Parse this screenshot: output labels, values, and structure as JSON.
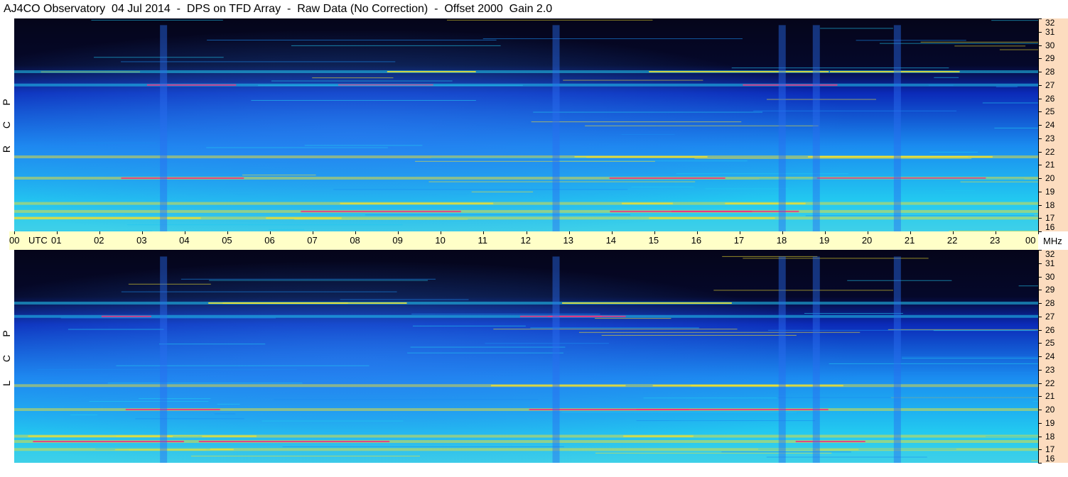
{
  "title": "AJ4CO Observatory  04 Jul 2014  -  DPS on TFD Array  -  Raw Data (No Correction)  -  Offset 2000  Gain 2.0",
  "colors": {
    "background_dark": "#05051a",
    "low": "#0a30c8",
    "mid": "#1a8cf0",
    "high": "#22c8f0",
    "hot": "#f0e030",
    "peak": "#f03080",
    "freq_axis_bg": "#fcdcbf",
    "time_axis_bg": "#ffffc8"
  },
  "chart_data": [
    {
      "type": "heatmap",
      "name": "R C P",
      "panel_label": [
        "R",
        "C",
        "P"
      ],
      "xlabel": "UTC",
      "ylabel": "MHz",
      "xlim": [
        0,
        24
      ],
      "ylim": [
        16,
        32
      ],
      "y_ticks": [
        "16",
        "17",
        "18",
        "19",
        "20",
        "21",
        "22",
        "23",
        "24",
        "25",
        "26",
        "27",
        "28",
        "29",
        "30",
        "31",
        "32"
      ],
      "bright_bands_mhz": [
        17.0,
        17.5,
        18.1,
        20.0,
        21.6,
        27.0,
        28.0
      ],
      "vertical_bursts_utc": [
        3.5,
        12.7,
        18.0,
        18.8,
        20.7
      ]
    },
    {
      "type": "heatmap",
      "name": "L C P",
      "panel_label": [
        "L",
        "C",
        "P"
      ],
      "xlabel": "UTC",
      "ylabel": "MHz",
      "xlim": [
        0,
        24
      ],
      "ylim": [
        16,
        32
      ],
      "y_ticks": [
        "16",
        "17",
        "18",
        "19",
        "20",
        "21",
        "22",
        "23",
        "24",
        "25",
        "26",
        "27",
        "28",
        "29",
        "30",
        "31",
        "32"
      ],
      "bright_bands_mhz": [
        17.0,
        17.6,
        18.0,
        20.0,
        21.8,
        27.0,
        28.0
      ],
      "vertical_bursts_utc": [
        3.5,
        12.7,
        18.0,
        18.8,
        20.7
      ]
    }
  ],
  "time_axis": {
    "labels": [
      "00",
      "01",
      "02",
      "03",
      "04",
      "05",
      "06",
      "07",
      "08",
      "09",
      "10",
      "11",
      "12",
      "13",
      "14",
      "15",
      "16",
      "17",
      "18",
      "19",
      "20",
      "21",
      "22",
      "23",
      "00"
    ],
    "utc_label": "UTC",
    "mhz_label": "MHz"
  }
}
